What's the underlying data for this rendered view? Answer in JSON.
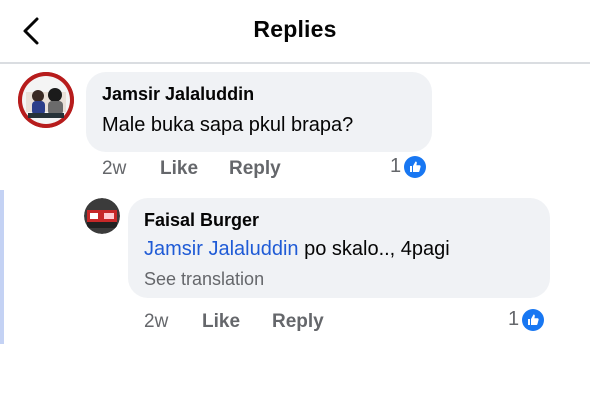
{
  "header": {
    "title": "Replies"
  },
  "comment": {
    "author": "Jamsir Jalaluddin",
    "text": "Male buka sapa pkul brapa?",
    "time": "2w",
    "like_label": "Like",
    "reply_label": "Reply",
    "like_count": "1"
  },
  "reply": {
    "author": "Faisal Burger",
    "mention": "Jamsir Jalaluddin",
    "text": " po skalo.., 4pagi",
    "translate": "See translation",
    "time": "2w",
    "like_label": "Like",
    "reply_label": "Reply",
    "like_count": "1"
  },
  "colors": {
    "accent": "#1877f2",
    "mention": "#1f5bd6",
    "bubble": "#f0f2f5",
    "meta": "#65676b"
  }
}
